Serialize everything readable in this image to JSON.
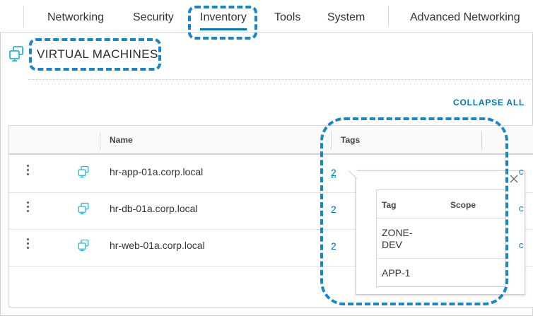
{
  "nav": {
    "tabs": [
      {
        "label": "Networking"
      },
      {
        "label": "Security"
      },
      {
        "label": "Inventory",
        "active": true
      },
      {
        "label": "Tools"
      },
      {
        "label": "System"
      },
      {
        "label": "Advanced Networking"
      }
    ]
  },
  "page": {
    "title": "VIRTUAL MACHINES",
    "icon": "virtual-machines-icon"
  },
  "toolbar": {
    "collapse_all": "COLLAPSE ALL"
  },
  "grid": {
    "columns": {
      "name": "Name",
      "tags": "Tags"
    },
    "rows": [
      {
        "name": "hr-app-01a.corp.local",
        "tags": "2"
      },
      {
        "name": "hr-db-01a.corp.local",
        "tags": "2"
      },
      {
        "name": "hr-web-01a.corp.local",
        "tags": "2"
      }
    ]
  },
  "popover": {
    "columns": {
      "tag": "Tag",
      "scope": "Scope"
    },
    "rows": [
      {
        "tag": "ZONE-DEV",
        "scope": ""
      },
      {
        "tag": "APP-1",
        "scope": ""
      }
    ]
  },
  "colors": {
    "accent": "#0079b8",
    "callout": "#1a86c8",
    "vm_icon": "#29b6d8"
  }
}
